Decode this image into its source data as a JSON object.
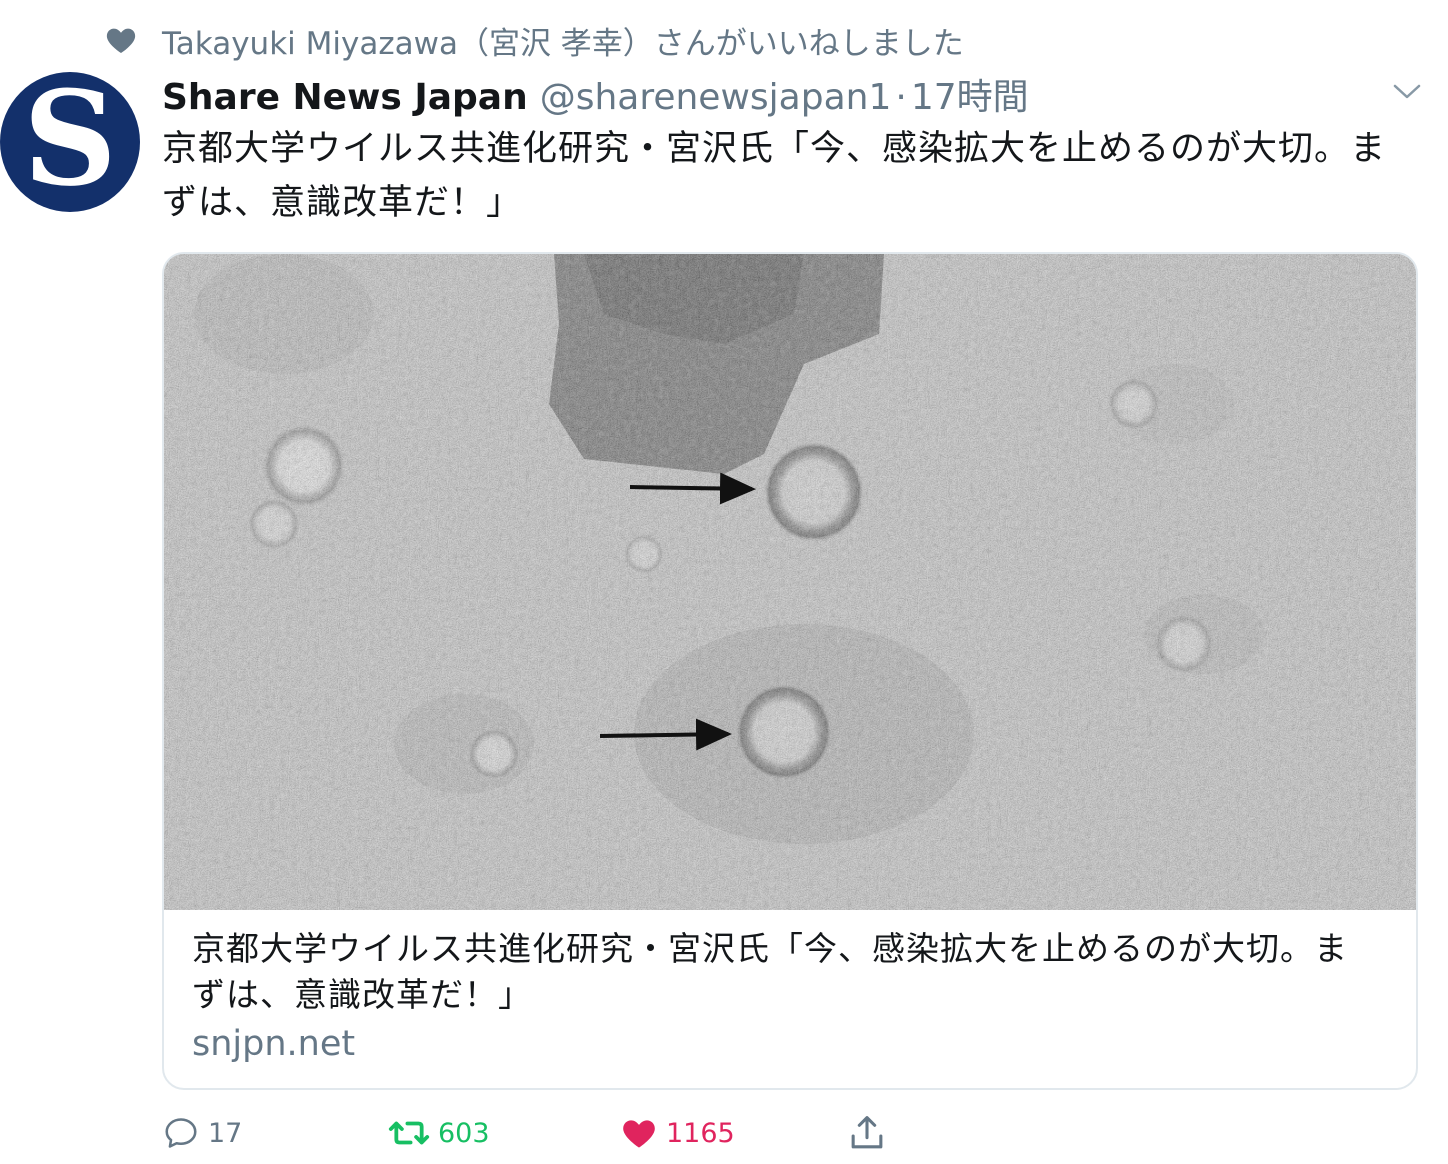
{
  "social_context": {
    "text": "Takayuki Miyazawa（宮沢 孝幸）さんがいいねしました",
    "icon": "heart-icon"
  },
  "author": {
    "avatar_letter": "S",
    "name": "Share News Japan",
    "handle": "@sharenewsjapan1",
    "separator": "·",
    "time": "17時間"
  },
  "tweet": {
    "text": "京都大学ウイルス共進化研究・宮沢氏「今、感染拡大を止めるのが大切。まずは、意識改革だ！」"
  },
  "card": {
    "image_alt": "electron microscope virus image",
    "title": "京都大学ウイルス共進化研究・宮沢氏「今、感染拡大を止めるのが大切。まずは、意識改革だ！」",
    "domain": "snjpn.net"
  },
  "actions": {
    "reply_count": "17",
    "retweet_count": "603",
    "like_count": "1165"
  },
  "colors": {
    "brand": "#13306b",
    "retweet": "#17bf63",
    "like": "#e0245e",
    "secondary_text": "#657786"
  }
}
